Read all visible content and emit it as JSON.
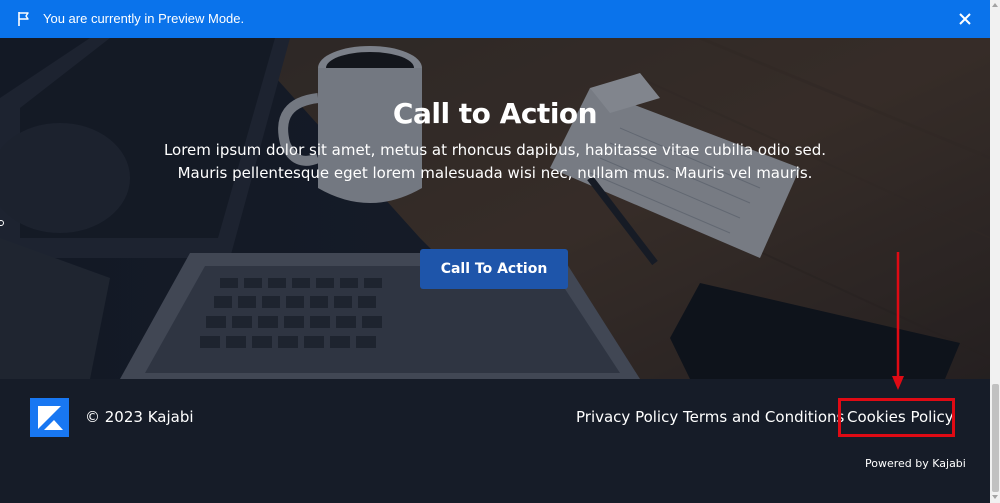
{
  "banner": {
    "message": "You are currently in Preview Mode.",
    "flag_icon": "flag-icon",
    "close_icon": "close-icon",
    "color": "#0a73eb"
  },
  "hero": {
    "title": "Call to Action",
    "line1": "Lorem ipsum dolor sit amet, metus at rhoncus dapibus, habitasse vitae cubilia odio sed.",
    "line2": "Mauris pellentesque eget lorem malesuada wisi nec, nullam mus. Mauris vel mauris.",
    "cta_label": "Call To Action",
    "cta_color": "#1e55aa"
  },
  "footer": {
    "logo_icon": "kajabi-logo-icon",
    "copyright": "© 2023 Kajabi",
    "links": [
      "Privacy Policy",
      "Terms and Conditions",
      "Cookies Policy"
    ],
    "powered_by": "Powered by Kajabi",
    "background": "#161c28"
  },
  "annotation": {
    "color": "#e00a14"
  }
}
